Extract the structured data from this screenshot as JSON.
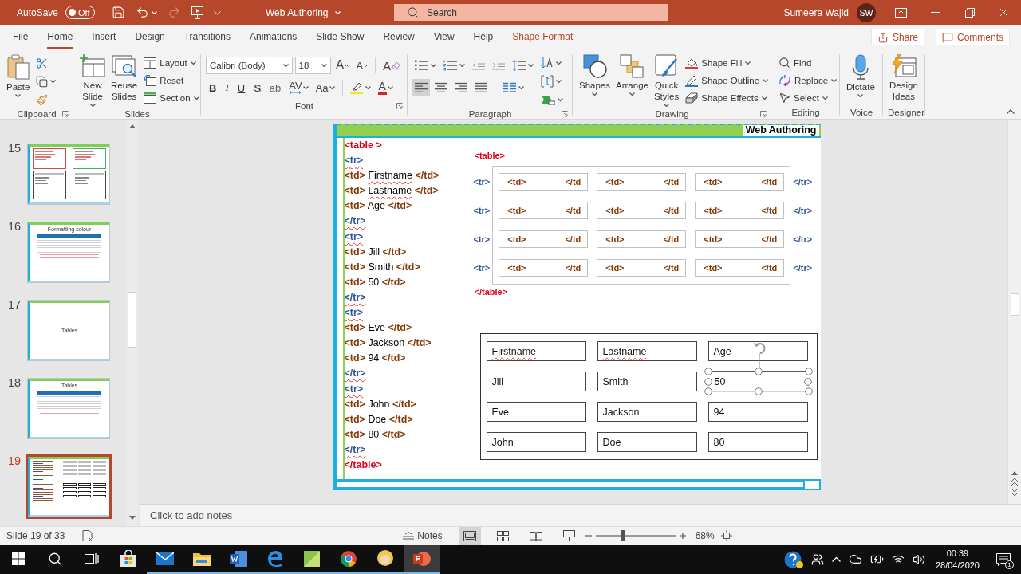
{
  "title_bar": {
    "autosave_label": "AutoSave",
    "autosave_state": "Off",
    "autosave_on": false,
    "redo_disabled": true,
    "document_title": "Web Authoring",
    "search": {
      "placeholder": "Search"
    },
    "user_name": "Sumeera Wajid",
    "user_initials": "SW"
  },
  "ribbon_tabs": [
    {
      "label": "File",
      "selected": false,
      "kind": "standard"
    },
    {
      "label": "Home",
      "selected": true,
      "kind": "standard"
    },
    {
      "label": "Insert",
      "selected": false,
      "kind": "standard"
    },
    {
      "label": "Design",
      "selected": false,
      "kind": "standard"
    },
    {
      "label": "Transitions",
      "selected": false,
      "kind": "standard"
    },
    {
      "label": "Animations",
      "selected": false,
      "kind": "standard"
    },
    {
      "label": "Slide Show",
      "selected": false,
      "kind": "standard"
    },
    {
      "label": "Review",
      "selected": false,
      "kind": "standard"
    },
    {
      "label": "View",
      "selected": false,
      "kind": "standard"
    },
    {
      "label": "Help",
      "selected": false,
      "kind": "standard"
    },
    {
      "label": "Shape Format",
      "selected": false,
      "kind": "contextual"
    }
  ],
  "ribbon_actions": {
    "share": "Share",
    "comments": "Comments"
  },
  "ribbon": {
    "clipboard": {
      "label": "Clipboard",
      "paste": "Paste"
    },
    "slides": {
      "label": "Slides",
      "new_slide": "New Slide",
      "reuse_slides": "Reuse Slides",
      "layout": "Layout",
      "reset": "Reset",
      "section": "Section"
    },
    "font": {
      "label": "Font",
      "font_name": "Calibri (Body)",
      "font_size": "18",
      "grow": "A",
      "shrink": "A",
      "clear": "A",
      "styles": [
        {
          "label": "B",
          "kind": "bold"
        },
        {
          "label": "I",
          "kind": "italic"
        },
        {
          "label": "U",
          "kind": "underline"
        },
        {
          "label": "S",
          "kind": "shadow"
        },
        {
          "label": "ab",
          "kind": "strike"
        }
      ],
      "spacing": "AV",
      "change_case": "Aa",
      "font_color": "A"
    },
    "paragraph": {
      "label": "Paragraph",
      "alignments": [
        {
          "kind": "left",
          "selected": true
        },
        {
          "kind": "center",
          "selected": false
        },
        {
          "kind": "right",
          "selected": false
        },
        {
          "kind": "justify",
          "selected": false
        }
      ]
    },
    "drawing": {
      "label": "Drawing",
      "shapes": "Shapes",
      "arrange": "Arrange",
      "quick_styles": "Quick Styles",
      "shape_fill": "Shape Fill",
      "shape_outline": "Shape Outline",
      "shape_effects": "Shape Effects"
    },
    "editing": {
      "label": "Editing",
      "find": "Find",
      "replace": "Replace",
      "select": "Select"
    },
    "voice": {
      "label": "Voice",
      "dictate": "Dictate"
    },
    "designer": {
      "label": "Designer",
      "design_ideas": "Design Ideas"
    }
  },
  "slide_thumbnails": [
    {
      "number": "15",
      "selected": false,
      "kind": "lists"
    },
    {
      "number": "16",
      "selected": false,
      "kind": "table",
      "title": "Formatting colour"
    },
    {
      "number": "17",
      "selected": false,
      "kind": "title",
      "title": "Tables"
    },
    {
      "number": "18",
      "selected": false,
      "kind": "table",
      "title": "Tables"
    },
    {
      "number": "19",
      "selected": true,
      "kind": "current"
    }
  ],
  "slide": {
    "header": "Web Authoring",
    "code_lines": [
      {
        "kind": "table",
        "text": "<table >",
        "misspelled": false
      },
      {
        "kind": "tr",
        "text": "<tr>",
        "misspelled": true
      },
      {
        "kind": "td",
        "open": "<td>",
        "content": "Firstname",
        "close": "</td>",
        "misspelled": true
      },
      {
        "kind": "td",
        "open": "<td>",
        "content": "Lastname",
        "close": "</td>",
        "misspelled": true
      },
      {
        "kind": "td",
        "open": "<td>",
        "content": "Age",
        "close": "</td>",
        "misspelled": false
      },
      {
        "kind": "tr",
        "text": "</tr>",
        "misspelled": true
      },
      {
        "kind": "tr",
        "text": "<tr>",
        "misspelled": true
      },
      {
        "kind": "td",
        "open": "<td>",
        "content": "Jill",
        "close": "</td>",
        "misspelled": false
      },
      {
        "kind": "td",
        "open": "<td>",
        "content": "Smith",
        "close": "</td>",
        "misspelled": false
      },
      {
        "kind": "td",
        "open": "<td>",
        "content": "50",
        "close": "</td>",
        "misspelled": false
      },
      {
        "kind": "tr",
        "text": "</tr>",
        "misspelled": true
      },
      {
        "kind": "tr",
        "text": "<tr>",
        "misspelled": true
      },
      {
        "kind": "td",
        "open": "<td>",
        "content": "Eve",
        "close": "</td>",
        "misspelled": false
      },
      {
        "kind": "td",
        "open": "<td>",
        "content": "Jackson",
        "close": "</td>",
        "misspelled": false
      },
      {
        "kind": "td",
        "open": "<td>",
        "content": "94",
        "close": "</td>",
        "misspelled": false
      },
      {
        "kind": "tr",
        "text": "</tr>",
        "misspelled": true
      },
      {
        "kind": "tr",
        "text": "<tr>",
        "misspelled": true
      },
      {
        "kind": "td",
        "open": "<td>",
        "content": "John",
        "close": "</td>",
        "misspelled": false
      },
      {
        "kind": "td",
        "open": "<td>",
        "content": "Doe",
        "close": "</td>",
        "misspelled": false
      },
      {
        "kind": "td",
        "open": "<td>",
        "content": "80",
        "close": "</td>",
        "misspelled": false
      },
      {
        "kind": "tr",
        "text": "</tr>",
        "misspelled": true
      },
      {
        "kind": "table",
        "text": "</table>",
        "misspelled": false
      }
    ],
    "diagram": {
      "table_open": "<table>",
      "rows": [
        {
          "open": "<tr>",
          "cells": [
            {
              "open": "<td>",
              "close": "</td"
            },
            {
              "open": "<td>",
              "close": "</td"
            },
            {
              "open": "<td>",
              "close": "</td"
            }
          ],
          "close": "</tr>"
        },
        {
          "open": "<tr>",
          "cells": [
            {
              "open": "<td>",
              "close": "</td"
            },
            {
              "open": "<td>",
              "close": "</td"
            },
            {
              "open": "<td>",
              "close": "</td"
            }
          ],
          "close": "</tr>"
        },
        {
          "open": "<tr>",
          "cells": [
            {
              "open": "<td>",
              "close": "</td"
            },
            {
              "open": "<td>",
              "close": "</td"
            },
            {
              "open": "<td>",
              "close": "</td"
            }
          ],
          "close": "</tr>"
        },
        {
          "open": "<tr>",
          "cells": [
            {
              "open": "<td>",
              "close": "</td"
            },
            {
              "open": "<td>",
              "close": "</td"
            },
            {
              "open": "<td>",
              "close": "</td"
            }
          ],
          "close": "</tr>"
        }
      ],
      "table_close": "</table>"
    },
    "result_table": {
      "rows": [
        {
          "cells": [
            {
              "text": "Firstname",
              "misspelled": true,
              "selected": false
            },
            {
              "text": "Lastname",
              "misspelled": true,
              "selected": false
            },
            {
              "text": "Age",
              "misspelled": false,
              "selected": false
            }
          ]
        },
        {
          "cells": [
            {
              "text": "Jill",
              "misspelled": false,
              "selected": false
            },
            {
              "text": "Smith",
              "misspelled": false,
              "selected": false
            },
            {
              "text": "50",
              "misspelled": false,
              "selected": true
            }
          ]
        },
        {
          "cells": [
            {
              "text": "Eve",
              "misspelled": false,
              "selected": false
            },
            {
              "text": "Jackson",
              "misspelled": false,
              "selected": false
            },
            {
              "text": "94",
              "misspelled": false,
              "selected": false
            }
          ]
        },
        {
          "cells": [
            {
              "text": "John",
              "misspelled": false,
              "selected": false
            },
            {
              "text": "Doe",
              "misspelled": false,
              "selected": false
            },
            {
              "text": "80",
              "misspelled": false,
              "selected": false
            }
          ]
        }
      ]
    }
  },
  "notes": {
    "placeholder": "Click to add notes"
  },
  "status_bar": {
    "slide_position": "Slide 19 of 33",
    "notes_button": "Notes",
    "views": [
      {
        "selected": true
      },
      {
        "selected": false
      },
      {
        "selected": false
      },
      {
        "selected": false
      }
    ],
    "zoom": {
      "level": 0.34,
      "reading": "68%"
    }
  },
  "taskbar": {
    "apps": [
      {
        "running": false,
        "active": false
      },
      {
        "running": true,
        "active": false
      },
      {
        "running": true,
        "active": false
      },
      {
        "running": true,
        "active": false
      },
      {
        "running": true,
        "active": false
      },
      {
        "running": true,
        "active": false
      },
      {
        "running": true,
        "active": false
      },
      {
        "running": true,
        "active": false
      },
      {
        "running": true,
        "active": true
      }
    ],
    "time": "00:39",
    "date": "28/04/2020",
    "notification_count": "1"
  }
}
